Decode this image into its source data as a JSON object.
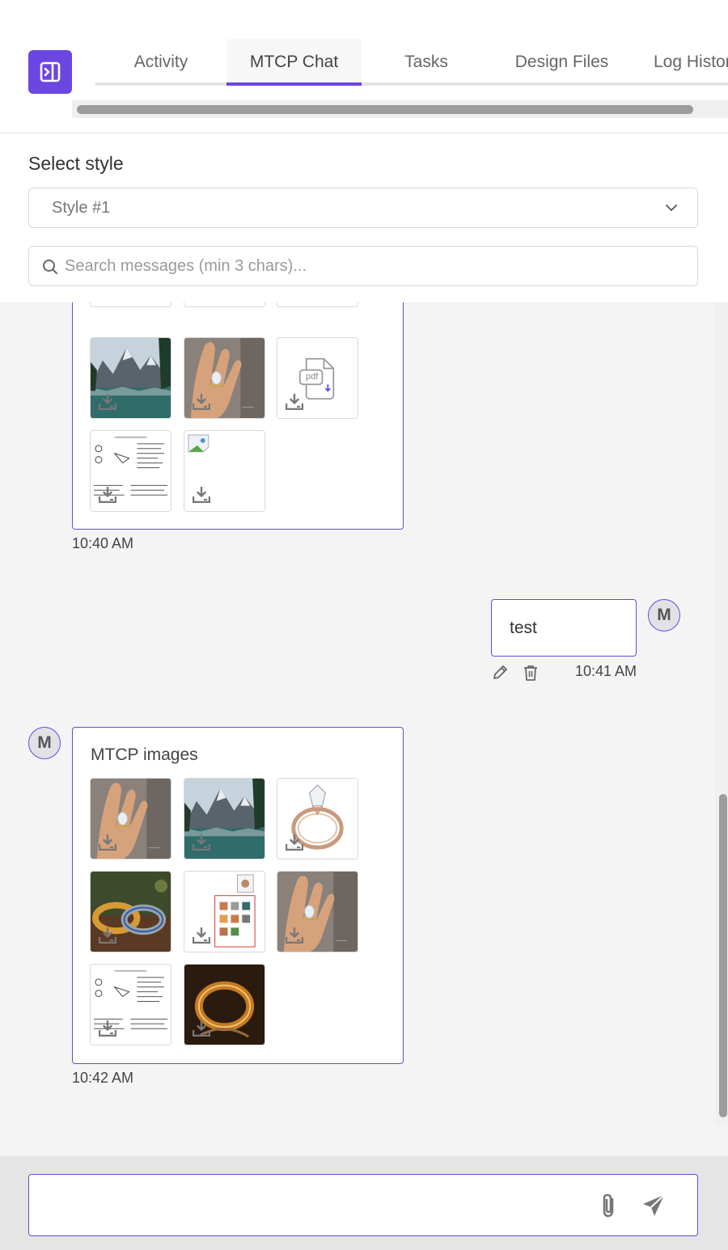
{
  "header": {
    "sidebar_toggle_icon": "panel-collapse-icon",
    "tabs": [
      {
        "label": "Activity",
        "active": false
      },
      {
        "label": "MTCP Chat",
        "active": true
      },
      {
        "label": "Tasks",
        "active": false
      },
      {
        "label": "Design Files",
        "active": false
      },
      {
        "label": "Log History",
        "active": false
      }
    ]
  },
  "filters": {
    "select_label": "Select style",
    "select_value": "Style #1",
    "search_placeholder": "Search messages (min 3 chars)..."
  },
  "messages": [
    {
      "side": "left",
      "time": "10:40 AM",
      "attachments": [
        "image",
        "image",
        "image",
        "landscape",
        "ring-on-hand",
        "pdf",
        "document-sketch",
        "broken-image"
      ]
    },
    {
      "side": "right",
      "text": "test",
      "time": "10:41 AM",
      "avatar": "M",
      "actions": [
        "edit-icon",
        "trash-icon"
      ]
    },
    {
      "side": "left",
      "avatar": "M",
      "title": "MTCP images",
      "time": "10:42 AM",
      "attachments": [
        "ring-on-hand",
        "landscape",
        "solitaire-ring",
        "wedding-bands",
        "spec-sheet",
        "ring-on-hand",
        "document-sketch",
        "gold-ring"
      ]
    }
  ],
  "pdf_label": "pdf",
  "composer": {
    "placeholder": "",
    "attach_icon": "paperclip-icon",
    "send_icon": "send-icon"
  },
  "colors": {
    "accent": "#6b46e0",
    "chat_bg": "#f4f4f4",
    "composer_bg": "#e5e5e5"
  }
}
